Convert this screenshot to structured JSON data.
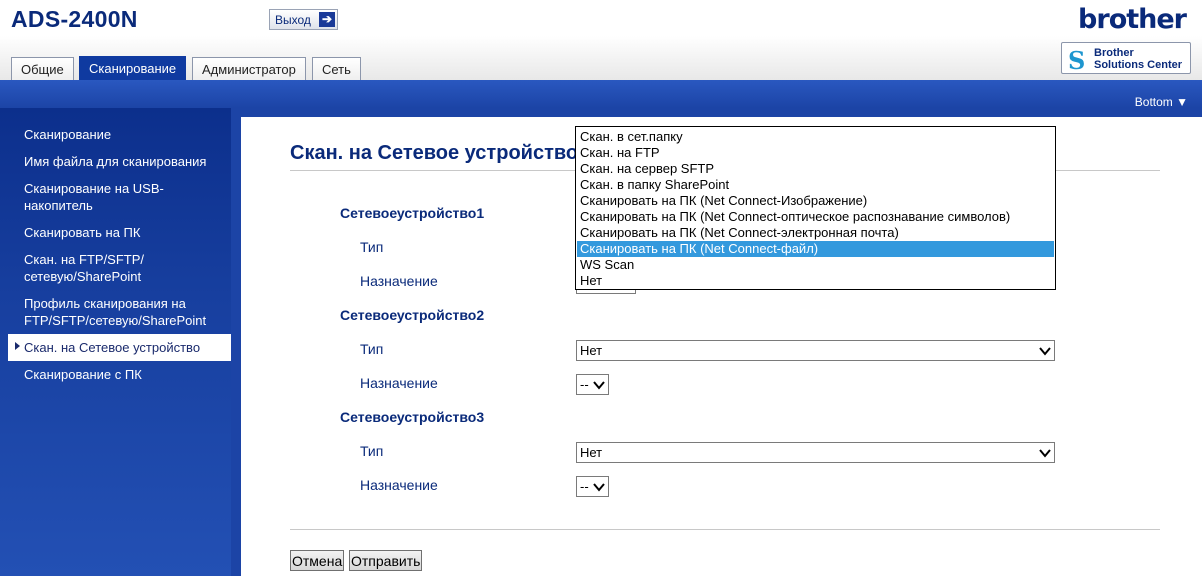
{
  "header": {
    "model": "ADS-2400N",
    "logout_label": "Выход",
    "brand": "brother",
    "solutions_line1": "Brother",
    "solutions_line2": "Solutions Center"
  },
  "tabs": [
    {
      "label": "Общие"
    },
    {
      "label": "Сканирование"
    },
    {
      "label": "Администратор"
    },
    {
      "label": "Сеть"
    }
  ],
  "bottom_link": "Bottom ▼",
  "sidebar": {
    "items": [
      {
        "label": "Сканирование"
      },
      {
        "label": "Имя файла для сканирования"
      },
      {
        "label": "Сканирование на USB-накопитель"
      },
      {
        "label": "Сканировать на ПК"
      },
      {
        "label": "Скан. на FTP/SFTP/сетевую/SharePoint"
      },
      {
        "label": "Профиль сканирования на FTP/SFTP/сетевую/SharePoint"
      },
      {
        "label": "Скан. на Сетевое устройство"
      },
      {
        "label": "Сканирование с ПК"
      }
    ]
  },
  "main": {
    "title": "Скан. на Сетевое устройство",
    "type_label": "Тип",
    "dest_label": "Назначение",
    "devices": [
      {
        "name": "Сетевоеустройство1",
        "type_value": "",
        "dest_value": ""
      },
      {
        "name": "Сетевоеустройство2",
        "type_value": "Нет",
        "dest_value": "--"
      },
      {
        "name": "Сетевоеустройство3",
        "type_value": "Нет",
        "dest_value": "--"
      }
    ],
    "cancel_label": "Отмена",
    "submit_label": "Отправить"
  },
  "dropdown": {
    "options": [
      "Скан. в сет.папку",
      "Скан. на FTP",
      "Скан. на сервер SFTP",
      "Скан. в папку SharePoint",
      "Сканировать на ПК (Net Connect-Изображение)",
      "Сканировать на ПК (Net Connect-оптическое распознавание символов)",
      "Сканировать на ПК (Net Connect-электронная почта)",
      "Сканировать на ПК (Net Connect-файл)",
      "WS Scan",
      "Нет"
    ],
    "selected": "Сканировать на ПК (Net Connect-файл)"
  },
  "colors": {
    "nav_blue": "#0f3aa0",
    "highlight": "#3399dd",
    "text_navy": "#0a2a7a"
  }
}
